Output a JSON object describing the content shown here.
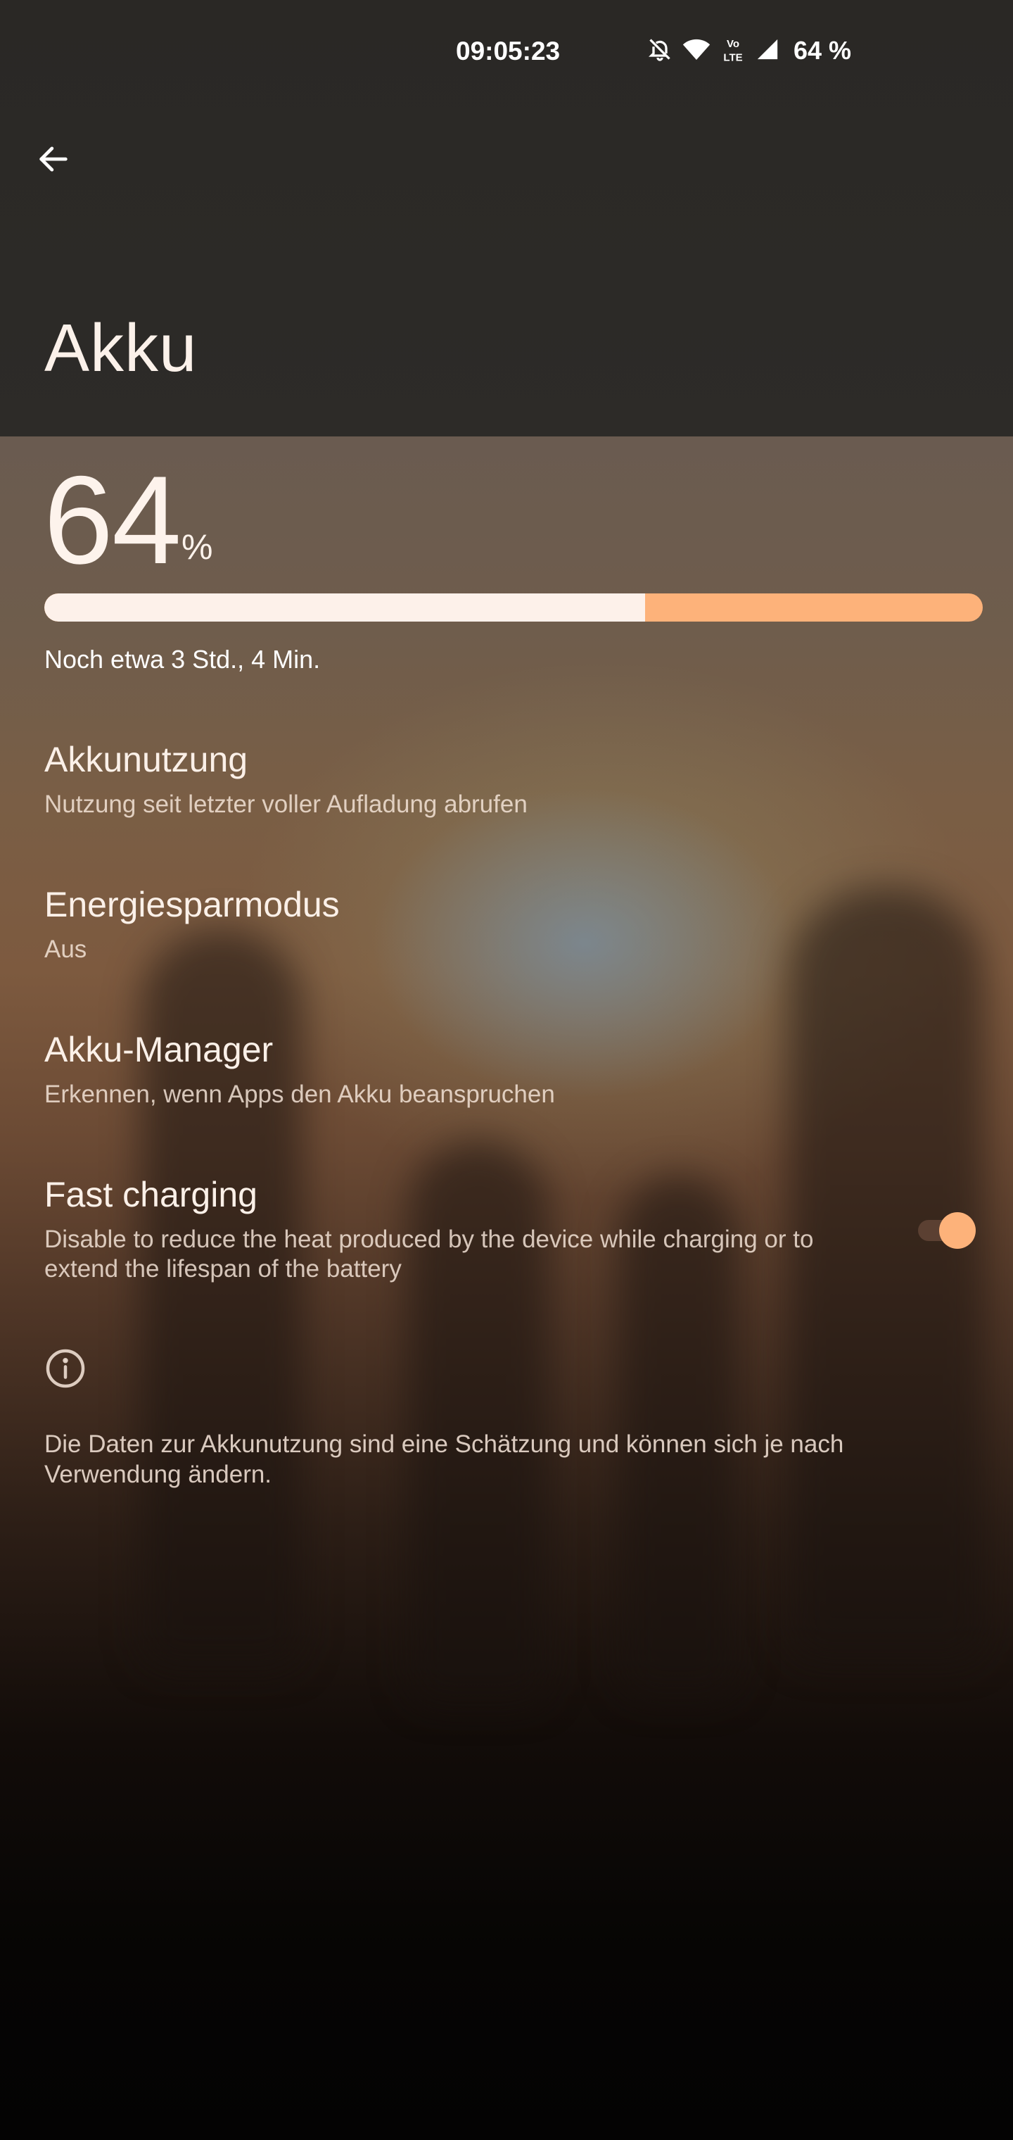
{
  "status_bar": {
    "time": "09:05:23",
    "battery_text": "64 %",
    "icons": [
      "bell-off-icon",
      "wifi-icon",
      "volte-icon",
      "signal-icon"
    ]
  },
  "header": {
    "title": "Akku"
  },
  "battery": {
    "percent": "64",
    "unit": "%",
    "level": 0.64,
    "remaining": "Noch etwa 3 Std., 4 Min."
  },
  "preferences": [
    {
      "title": "Akkunutzung",
      "summary": "Nutzung seit letzter voller Aufladung abrufen"
    },
    {
      "title": "Energiesparmodus",
      "summary": "Aus"
    },
    {
      "title": "Akku-Manager",
      "summary": "Erkennen, wenn Apps den Akku beanspruchen"
    },
    {
      "title": "Fast charging",
      "summary": "Disable to reduce the heat produced by the device while charging or to extend the lifespan of the battery",
      "toggle_on": true
    }
  ],
  "footer": {
    "note": "Die Daten zur Akkunutzung sind eine Schätzung und können sich je nach Verwendung ändern."
  },
  "colors": {
    "accent": "#fdb27a",
    "bar_fill": "#fdf1ea",
    "toolbar": "#2d2b28"
  }
}
